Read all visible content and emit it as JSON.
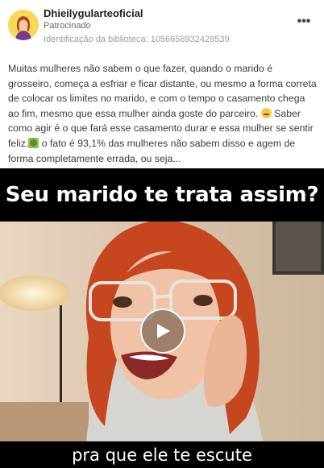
{
  "post": {
    "page_name": "Dhieilygularteoficial",
    "sponsored_label": "Patrocinado",
    "library_id": "Identificação da biblioteca: 1056658932428539",
    "more_label": "•••",
    "text_part1": "Muitas mulheres não sabem o que fazer, quando o marido é grosseiro, começa a esfriar e ficar distante, ou mesmo a forma correta de colocar os limites no marido, e com o tempo o casamento chega ao fim, mesmo que essa mulher ainda goste do parceiro. ",
    "text_part2": " Saber como agir é o que fará esse casamento durar e essa mulher se sentir feliz.",
    "text_part3": " o fato é 93,1% das mulheres não sabem disso e agem de forma completamente errada, ou seja..."
  },
  "video": {
    "title": "Seu marido te trata assim?",
    "subtitle": "pra que ele te escute"
  },
  "icons": {
    "avatar": "avatar-illustration",
    "more": "more-options-icon",
    "emoji1": "smiling-face-emoji",
    "emoji2": "money-emoji",
    "play": "play-icon"
  },
  "colors": {
    "page_name": "#1c1e21",
    "secondary_text": "#65676b",
    "body_text": "#3a3b3c",
    "video_band": "#000000",
    "hair": "#c5461f"
  }
}
